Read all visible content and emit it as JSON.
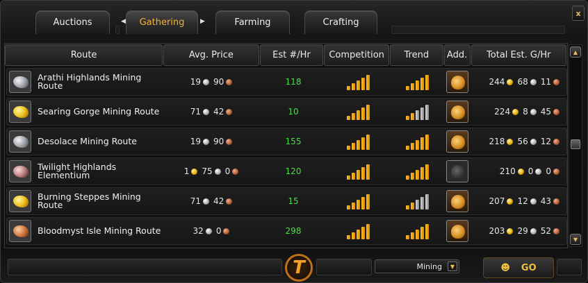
{
  "tabs": [
    {
      "label": "Auctions",
      "active": false
    },
    {
      "label": "Gathering",
      "active": true
    },
    {
      "label": "Farming",
      "active": false
    },
    {
      "label": "Crafting",
      "active": false
    }
  ],
  "close_label": "x",
  "columns": [
    "Route",
    "Avg. Price",
    "Est #/Hr",
    "Competition",
    "Trend",
    "Add.",
    "Total Est. G/Hr"
  ],
  "rows": [
    {
      "icon": "silver-ore-icon",
      "route": "Arathi Highlands Mining Route",
      "price": {
        "gold": "",
        "silver": "19",
        "copper": "90"
      },
      "est": "118",
      "competition": 5,
      "trend": 5,
      "add_icon": "loot-bag-icon",
      "total": {
        "gold": "244",
        "silver": "68",
        "copper": "11"
      }
    },
    {
      "icon": "gold-ore-icon",
      "route": "Searing Gorge Mining Route",
      "price": {
        "gold": "",
        "silver": "71",
        "copper": "42"
      },
      "est": "10",
      "competition": 5,
      "trend": 2,
      "add_icon": "loot-bag-icon",
      "total": {
        "gold": "224",
        "silver": "8",
        "copper": "45"
      }
    },
    {
      "icon": "silver-ore-icon",
      "route": "Desolace Mining Route",
      "price": {
        "gold": "",
        "silver": "19",
        "copper": "90"
      },
      "est": "155",
      "competition": 5,
      "trend": 5,
      "add_icon": "loot-bag-icon",
      "total": {
        "gold": "218",
        "silver": "56",
        "copper": "12"
      }
    },
    {
      "icon": "elementium-ore-icon",
      "route": "Twilight Highlands Elementium",
      "price": {
        "gold": "1",
        "silver": "75",
        "copper": "0"
      },
      "est": "120",
      "competition": 5,
      "trend": 5,
      "add_icon": "empty-bag-icon",
      "total": {
        "gold": "210",
        "silver": "0",
        "copper": "0"
      }
    },
    {
      "icon": "gold-ore-icon",
      "route": "Burning Steppes Mining Route",
      "price": {
        "gold": "",
        "silver": "71",
        "copper": "42"
      },
      "est": "15",
      "competition": 5,
      "trend": 2,
      "add_icon": "loot-bag-icon",
      "total": {
        "gold": "207",
        "silver": "12",
        "copper": "43"
      }
    },
    {
      "icon": "copper-ore-icon",
      "route": "Bloodmyst Isle Mining Route",
      "price": {
        "gold": "",
        "silver": "32",
        "copper": "0"
      },
      "est": "298",
      "competition": 5,
      "trend": 5,
      "add_icon": "loot-bag-icon",
      "total": {
        "gold": "203",
        "silver": "29",
        "copper": "52"
      }
    }
  ],
  "bottom": {
    "logo_letter": "T",
    "mode_value": "Mining",
    "go_label": "GO"
  },
  "colors": {
    "accent": "#f1b23a",
    "est_green": "#44e044"
  }
}
